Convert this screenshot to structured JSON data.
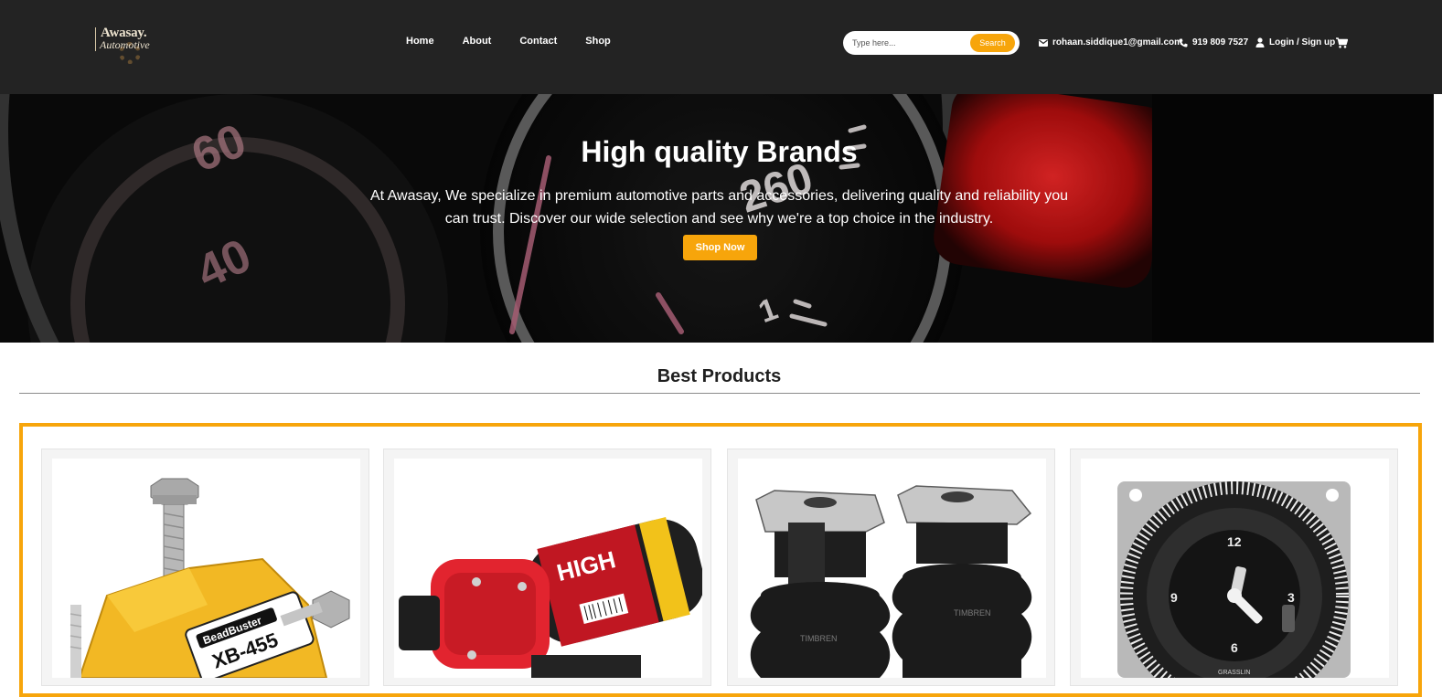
{
  "brand": {
    "line1": "Awasay.",
    "line2": "Automotive"
  },
  "nav": [
    "Home",
    "About",
    "Contact",
    "Shop"
  ],
  "search": {
    "placeholder": "Type here...",
    "button": "Search"
  },
  "contact": {
    "email": "rohaan.siddique1@gmail.com",
    "phone": "919 809 7527",
    "login": "Login / Sign up"
  },
  "icons": [
    "envelope-icon",
    "phone-icon",
    "user-icon",
    "cart-icon",
    "logo-gear-icon"
  ],
  "colors": {
    "header_bg": "#232323",
    "accent": "#f7a50b",
    "hero_red": "#e31a1a"
  },
  "hero": {
    "title": "High quality Brands",
    "description": "At Awasay, We specialize in premium automotive parts and accessories, delivering quality and reliability you can trust. Discover our wide selection and see why we're a top choice in the industry.",
    "button": "Shop Now",
    "speedometer_labels": [
      "60",
      "40",
      "260",
      "1"
    ]
  },
  "best_products": {
    "title": "Best Products",
    "items": [
      {
        "product_label": "BeadBuster",
        "model": "XB-455"
      },
      {
        "product_label": "HIGH"
      },
      {
        "product_label": "TIMBREN"
      },
      {
        "product_label": "GRASSLIN",
        "dial_numbers": [
          "12",
          "9",
          "6",
          "3"
        ]
      }
    ]
  }
}
